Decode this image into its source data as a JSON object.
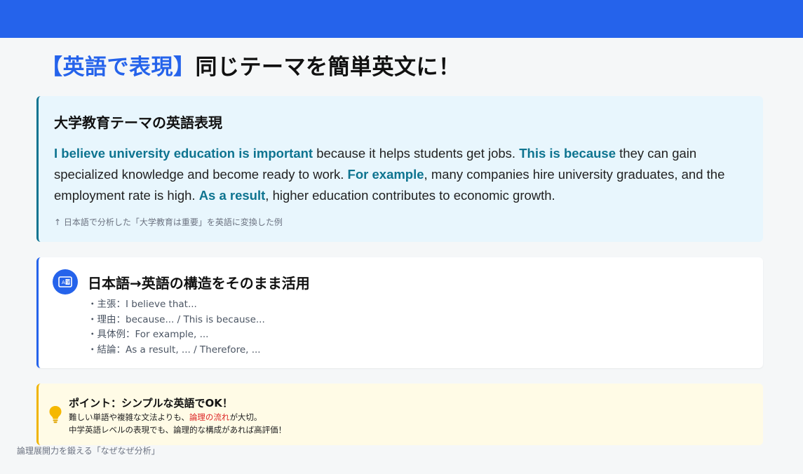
{
  "title": {
    "accent": "【英語で表現】",
    "main": "同じテーマを簡単英文に！"
  },
  "example_card": {
    "heading": "大学教育テーマの英語表現",
    "segments": [
      {
        "text": "I believe university education is important",
        "highlight": true
      },
      {
        "text": " because it helps students get jobs. ",
        "highlight": false
      },
      {
        "text": "This is because",
        "highlight": true
      },
      {
        "text": " they can gain specialized knowledge and become ready to work. ",
        "highlight": false
      },
      {
        "text": "For example",
        "highlight": true
      },
      {
        "text": ", many companies hire university graduates, and the employment rate is high. ",
        "highlight": false
      },
      {
        "text": "As a result",
        "highlight": true
      },
      {
        "text": ", higher education contributes to economic growth.",
        "highlight": false
      }
    ],
    "note": "↑ 日本語で分析した「大学教育は重要」を英語に変換した例"
  },
  "structure_card": {
    "icon": "translate-icon",
    "heading": "日本語→英語の構造をそのまま活用",
    "items": [
      "・主張：I believe that...",
      "・理由：because... / This is because...",
      "・具体例：For example, ...",
      "・結論：As a result, ... / Therefore, ..."
    ]
  },
  "point_card": {
    "icon": "lightbulb-icon",
    "heading": "ポイント：シンプルな英語でOK！",
    "line1_before": "難しい単語や複雑な文法よりも、",
    "line1_highlight": "論理の流れ",
    "line1_after": "が大切。",
    "line2": "中学英語レベルの表現でも、論理的な構成があれば高評価！"
  },
  "footer_caption": "論理展開力を鍛える「なぜなぜ分析」",
  "colors": {
    "primary": "#2563eb",
    "teal": "#0e7490",
    "amber": "#f0b400",
    "red": "#dc2626"
  }
}
